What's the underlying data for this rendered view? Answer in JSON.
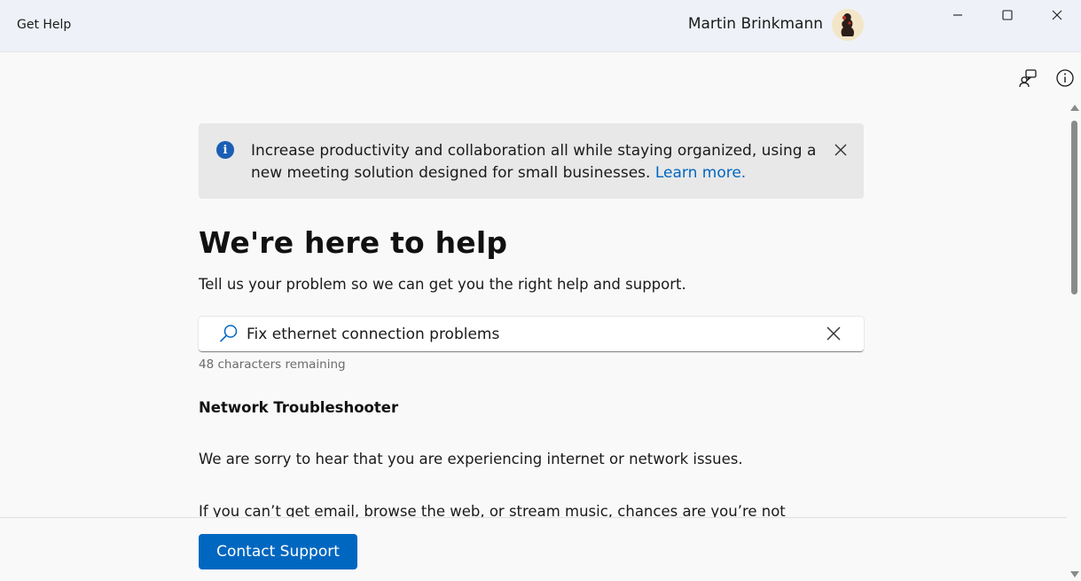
{
  "window": {
    "title": "Get Help",
    "user_name": "Martin Brinkmann"
  },
  "banner": {
    "text": "Increase productivity and collaboration all while staying organized, using a new meeting solution designed for small businesses.",
    "link": "Learn more."
  },
  "main": {
    "title": "We're here to help",
    "subtitle": "Tell us your problem so we can get you the right help and support.",
    "search_value": "Fix ethernet connection problems",
    "chars_remaining": "48 characters remaining"
  },
  "result": {
    "title": "Network Troubleshooter",
    "paragraph1": "We are sorry to hear that you are experiencing internet or network issues.",
    "paragraph2": "If you can’t get email, browse the web, or stream music, chances are you’re not"
  },
  "footer": {
    "contact_label": "Contact Support"
  },
  "colors": {
    "accent": "#0067c0",
    "titlebar": "#eef2f8",
    "banner_bg": "#e8e8e8"
  },
  "icons": {
    "minimize": "minimize-icon",
    "maximize": "maximize-icon",
    "close": "close-icon",
    "contact": "contact-icon",
    "info": "info-icon",
    "search": "search-icon"
  }
}
